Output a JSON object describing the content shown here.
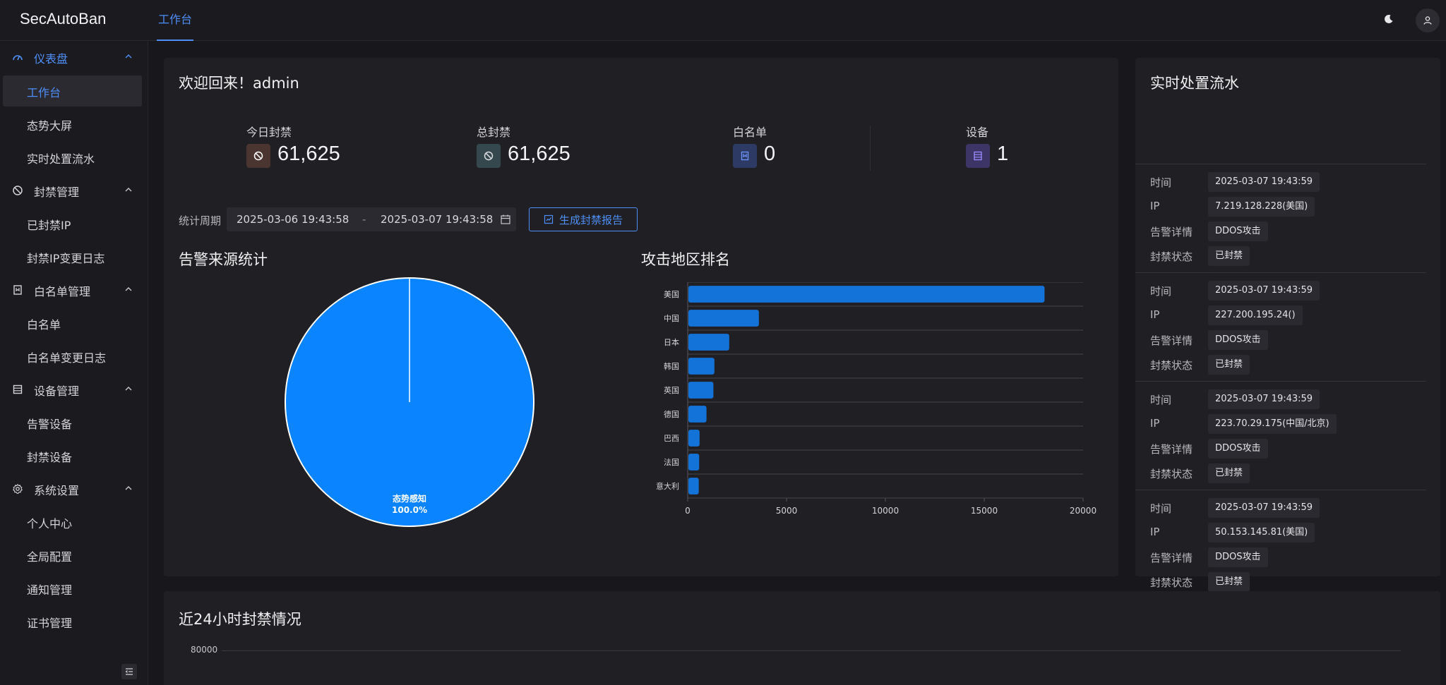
{
  "app": {
    "logo": "SecAutoBan"
  },
  "topbar": {
    "tab": "工作台",
    "theme_icon": "moon-icon",
    "user_icon": "user-icon"
  },
  "sidebar": {
    "groups": [
      {
        "label": "仪表盘",
        "icon": "dashboard-icon",
        "active": true,
        "items": [
          {
            "label": "工作台",
            "selected": true
          },
          {
            "label": "态势大屏"
          },
          {
            "label": "实时处置流水"
          }
        ]
      },
      {
        "label": "封禁管理",
        "icon": "ban-icon",
        "items": [
          {
            "label": "已封禁IP"
          },
          {
            "label": "封禁IP变更日志"
          }
        ]
      },
      {
        "label": "白名单管理",
        "icon": "bookmark-icon",
        "items": [
          {
            "label": "白名单"
          },
          {
            "label": "白名单变更日志"
          }
        ]
      },
      {
        "label": "设备管理",
        "icon": "server-icon",
        "items": [
          {
            "label": "告警设备"
          },
          {
            "label": "封禁设备"
          }
        ]
      },
      {
        "label": "系统设置",
        "icon": "gear-icon",
        "items": [
          {
            "label": "个人中心"
          },
          {
            "label": "全局配置"
          },
          {
            "label": "通知管理"
          },
          {
            "label": "证书管理"
          }
        ]
      }
    ]
  },
  "main": {
    "welcome": "欢迎回来！admin",
    "stats": [
      {
        "label": "今日封禁",
        "value": "61,625",
        "icon": "ban-icon",
        "color": "#4a3530"
      },
      {
        "label": "总封禁",
        "value": "61,625",
        "icon": "ban-icon",
        "color": "#34484d"
      },
      {
        "label": "白名单",
        "value": "0",
        "icon": "bookmark-icon",
        "color": "#2d3a63"
      },
      {
        "label": "设备",
        "value": "1",
        "icon": "server-icon",
        "color": "#3d3566"
      }
    ],
    "period": {
      "label": "统计周期",
      "start": "2025-03-06 19:43:58",
      "separator": "-",
      "end": "2025-03-07 19:43:58",
      "report_button": "生成封禁报告"
    },
    "pie_title": "告警来源统计",
    "bar_title": "攻击地区排名"
  },
  "bottom": {
    "title": "近24小时封禁情况",
    "tick": "80000"
  },
  "feed": {
    "title": "实时处置流水",
    "keys": {
      "time": "时间",
      "ip": "IP",
      "detail": "告警详情",
      "status": "封禁状态"
    },
    "entries": [
      {
        "time": "2025-03-07 19:43:59",
        "ip": "7.219.128.228(美国)",
        "detail": "DDOS攻击",
        "status": "已封禁"
      },
      {
        "time": "2025-03-07 19:43:59",
        "ip": "227.200.195.24()",
        "detail": "DDOS攻击",
        "status": "已封禁"
      },
      {
        "time": "2025-03-07 19:43:59",
        "ip": "223.70.29.175(中国/北京)",
        "detail": "DDOS攻击",
        "status": "已封禁"
      },
      {
        "time": "2025-03-07 19:43:59",
        "ip": "50.153.145.81(美国)",
        "detail": "DDOS攻击",
        "status": "已封禁"
      }
    ]
  },
  "chart_data": [
    {
      "type": "pie",
      "title": "告警来源统计",
      "slices": [
        {
          "label": "态势感知",
          "value": 100.0,
          "display": "100.0%",
          "color": "#0a84ff"
        }
      ]
    },
    {
      "type": "bar",
      "orientation": "horizontal",
      "title": "攻击地区排名",
      "categories": [
        "美国",
        "中国",
        "日本",
        "韩国",
        "英国",
        "德国",
        "巴西",
        "法国",
        "意大利"
      ],
      "values": [
        18050,
        3600,
        2100,
        1350,
        1300,
        950,
        600,
        580,
        560
      ],
      "xlim": [
        0,
        20000
      ],
      "xticks": [
        "0",
        "5000",
        "10000",
        "15000",
        "20000"
      ],
      "color": "#1473d9"
    }
  ]
}
